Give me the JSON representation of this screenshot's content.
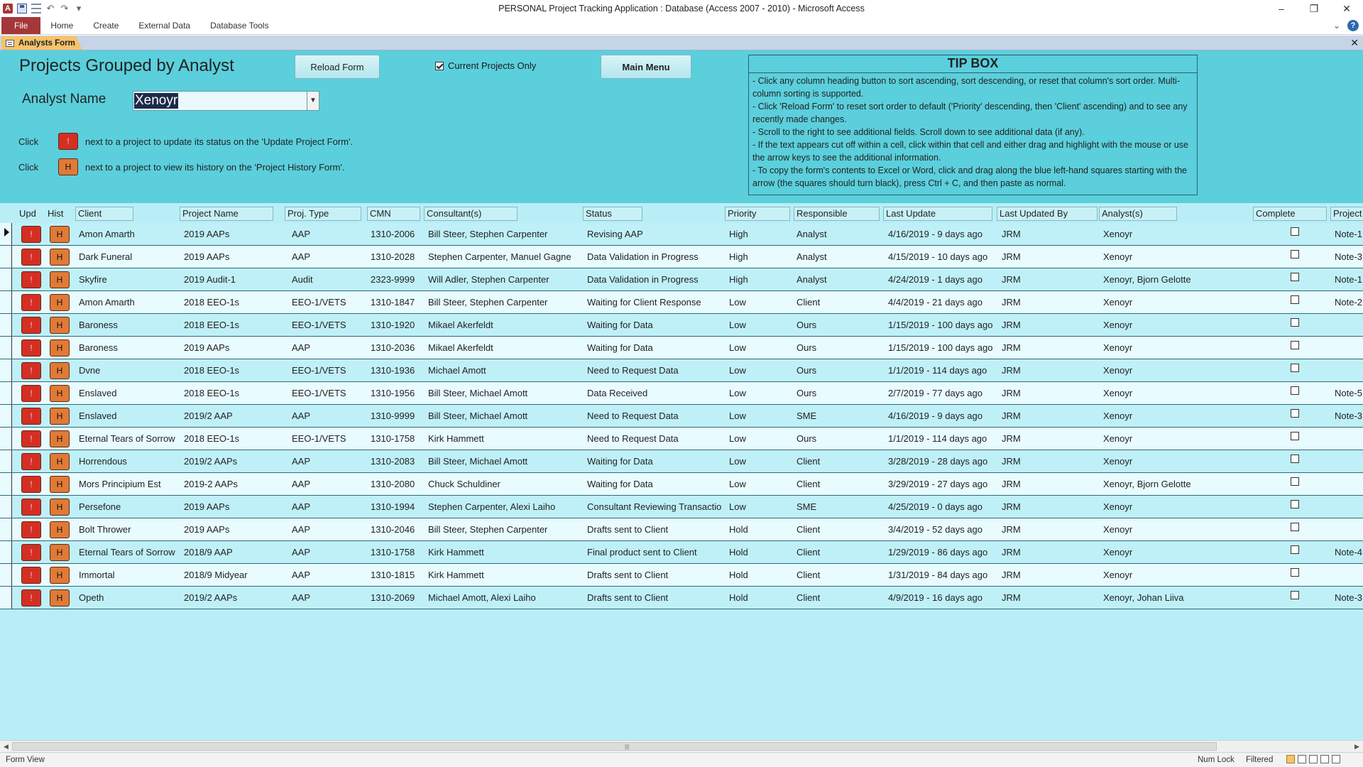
{
  "window": {
    "title": "PERSONAL Project Tracking Application : Database (Access 2007 - 2010)  -  Microsoft Access",
    "app_icon": "A",
    "minimize": "–",
    "restore": "❐",
    "close": "✕"
  },
  "ribbon": {
    "tabs": [
      "File",
      "Home",
      "Create",
      "External Data",
      "Database Tools"
    ],
    "collapse": "⌄",
    "help": "?"
  },
  "document": {
    "tab_label": "Analysts Form",
    "close": "✕"
  },
  "header": {
    "title": "Projects Grouped by Analyst",
    "reload_label": "Reload Form",
    "current_only_label": "Current Projects Only",
    "current_only_checked": true,
    "main_menu_label": "Main Menu",
    "analyst_label": "Analyst Name",
    "analyst_value": "Xenoyr",
    "help1_click": "Click",
    "help1_button": "!",
    "help1_text": "next to a project to update its status on the 'Update Project Form'.",
    "help2_click": "Click",
    "help2_button": "H",
    "help2_text": "next to a project to view its history on the 'Project History Form'."
  },
  "tipbox": {
    "title": "TIP BOX",
    "text": "- Click any column heading button to sort ascending, sort descending, or reset that column's sort order. Multi-column sorting is supported.\n- Click 'Reload Form' to reset sort order to default ('Priority' descending, then 'Client' ascending) and to see any recently made changes.\n- Scroll to the right to see additional fields. Scroll down to see additional data (if any).\n- If the text appears cut off within a cell, click within that cell and either drag and highlight with the mouse or use the arrow keys to see the additional information.\n- To copy the form's contents to Excel or Word, click and drag along the blue left-hand squares starting with the arrow (the squares should turn black), press Ctrl + C, and then paste as normal."
  },
  "columns": {
    "upd": "Upd",
    "hist": "Hist",
    "client": "Client",
    "project": "Project Name",
    "type": "Proj. Type",
    "cmn": "CMN",
    "consultants": "Consultant(s)",
    "status": "Status",
    "priority": "Priority",
    "responsible": "Responsible",
    "last_update": "Last Update",
    "last_by": "Last Updated By",
    "analysts": "Analyst(s)",
    "complete": "Complete",
    "notes": "Project"
  },
  "row_buttons": {
    "upd": "!",
    "hist": "H"
  },
  "rows": [
    {
      "client": "Amon Amarth",
      "project": "2019 AAPs",
      "type": "AAP",
      "cmn": "1310-2006",
      "consultants": "Bill Steer, Stephen Carpenter",
      "status": "Revising AAP",
      "priority": "High",
      "responsible": "Analyst",
      "last_update": "4/16/2019 - 9 days ago",
      "last_by": "JRM",
      "analysts": "Xenoyr",
      "complete": false,
      "notes": "Note-1"
    },
    {
      "client": "Dark Funeral",
      "project": "2019 AAPs",
      "type": "AAP",
      "cmn": "1310-2028",
      "consultants": "Stephen Carpenter, Manuel Gagne",
      "status": "Data Validation in Progress",
      "priority": "High",
      "responsible": "Analyst",
      "last_update": "4/15/2019 - 10 days ago",
      "last_by": "JRM",
      "analysts": "Xenoyr",
      "complete": false,
      "notes": "Note-3"
    },
    {
      "client": "Skyfire",
      "project": "2019 Audit-1",
      "type": "Audit",
      "cmn": "2323-9999",
      "consultants": "Will Adler, Stephen Carpenter",
      "status": "Data Validation in Progress",
      "priority": "High",
      "responsible": "Analyst",
      "last_update": "4/24/2019 - 1 days ago",
      "last_by": "JRM",
      "analysts": "Xenoyr, Bjorn Gelotte",
      "complete": false,
      "notes": "Note-1"
    },
    {
      "client": "Amon Amarth",
      "project": "2018 EEO-1s",
      "type": "EEO-1/VETS",
      "cmn": "1310-1847",
      "consultants": "Bill Steer, Stephen Carpenter",
      "status": "Waiting for Client Response",
      "priority": "Low",
      "responsible": "Client",
      "last_update": "4/4/2019 - 21 days ago",
      "last_by": "JRM",
      "analysts": "Xenoyr",
      "complete": false,
      "notes": "Note-2"
    },
    {
      "client": "Baroness",
      "project": "2018 EEO-1s",
      "type": "EEO-1/VETS",
      "cmn": "1310-1920",
      "consultants": "Mikael Akerfeldt",
      "status": "Waiting for Data",
      "priority": "Low",
      "responsible": "Ours",
      "last_update": "1/15/2019 - 100 days ago",
      "last_by": "JRM",
      "analysts": "Xenoyr",
      "complete": false,
      "notes": ""
    },
    {
      "client": "Baroness",
      "project": "2019 AAPs",
      "type": "AAP",
      "cmn": "1310-2036",
      "consultants": "Mikael Akerfeldt",
      "status": "Waiting for Data",
      "priority": "Low",
      "responsible": "Ours",
      "last_update": "1/15/2019 - 100 days ago",
      "last_by": "JRM",
      "analysts": "Xenoyr",
      "complete": false,
      "notes": ""
    },
    {
      "client": "Dvne",
      "project": "2018 EEO-1s",
      "type": "EEO-1/VETS",
      "cmn": "1310-1936",
      "consultants": "Michael Amott",
      "status": "Need to Request Data",
      "priority": "Low",
      "responsible": "Ours",
      "last_update": "1/1/2019 - 114 days ago",
      "last_by": "JRM",
      "analysts": "Xenoyr",
      "complete": false,
      "notes": ""
    },
    {
      "client": "Enslaved",
      "project": "2018 EEO-1s",
      "type": "EEO-1/VETS",
      "cmn": "1310-1956",
      "consultants": "Bill Steer, Michael Amott",
      "status": "Data Received",
      "priority": "Low",
      "responsible": "Ours",
      "last_update": "2/7/2019 - 77 days ago",
      "last_by": "JRM",
      "analysts": "Xenoyr",
      "complete": false,
      "notes": "Note-5"
    },
    {
      "client": "Enslaved",
      "project": "2019/2 AAP",
      "type": "AAP",
      "cmn": "1310-9999",
      "consultants": "Bill Steer, Michael Amott",
      "status": "Need to Request Data",
      "priority": "Low",
      "responsible": "SME",
      "last_update": "4/16/2019 - 9 days ago",
      "last_by": "JRM",
      "analysts": "Xenoyr",
      "complete": false,
      "notes": "Note-3"
    },
    {
      "client": "Eternal Tears of Sorrow",
      "project": "2018 EEO-1s",
      "type": "EEO-1/VETS",
      "cmn": "1310-1758",
      "consultants": "Kirk Hammett",
      "status": "Need to Request Data",
      "priority": "Low",
      "responsible": "Ours",
      "last_update": "1/1/2019 - 114 days ago",
      "last_by": "JRM",
      "analysts": "Xenoyr",
      "complete": false,
      "notes": ""
    },
    {
      "client": "Horrendous",
      "project": "2019/2 AAPs",
      "type": "AAP",
      "cmn": "1310-2083",
      "consultants": "Bill Steer, Michael Amott",
      "status": "Waiting for Data",
      "priority": "Low",
      "responsible": "Client",
      "last_update": "3/28/2019 - 28 days ago",
      "last_by": "JRM",
      "analysts": "Xenoyr",
      "complete": false,
      "notes": ""
    },
    {
      "client": "Mors Principium Est",
      "project": "2019-2 AAPs",
      "type": "AAP",
      "cmn": "1310-2080",
      "consultants": "Chuck Schuldiner",
      "status": "Waiting for Data",
      "priority": "Low",
      "responsible": "Client",
      "last_update": "3/29/2019 - 27 days ago",
      "last_by": "JRM",
      "analysts": "Xenoyr, Bjorn Gelotte",
      "complete": false,
      "notes": ""
    },
    {
      "client": "Persefone",
      "project": "2019 AAPs",
      "type": "AAP",
      "cmn": "1310-1994",
      "consultants": "Stephen Carpenter, Alexi Laiho",
      "status": "Consultant Reviewing Transactions",
      "priority": "Low",
      "responsible": "SME",
      "last_update": "4/25/2019 - 0 days ago",
      "last_by": "JRM",
      "analysts": "Xenoyr",
      "complete": false,
      "notes": ""
    },
    {
      "client": "Bolt Thrower",
      "project": "2019 AAPs",
      "type": "AAP",
      "cmn": "1310-2046",
      "consultants": "Bill Steer, Stephen Carpenter",
      "status": "Drafts sent to Client",
      "priority": "Hold",
      "responsible": "Client",
      "last_update": "3/4/2019 - 52 days ago",
      "last_by": "JRM",
      "analysts": "Xenoyr",
      "complete": false,
      "notes": ""
    },
    {
      "client": "Eternal Tears of Sorrow",
      "project": "2018/9 AAP",
      "type": "AAP",
      "cmn": "1310-1758",
      "consultants": "Kirk Hammett",
      "status": "Final product sent to Client",
      "priority": "Hold",
      "responsible": "Client",
      "last_update": "1/29/2019 - 86 days ago",
      "last_by": "JRM",
      "analysts": "Xenoyr",
      "complete": false,
      "notes": "Note-4"
    },
    {
      "client": "Immortal",
      "project": "2018/9 Midyear",
      "type": "AAP",
      "cmn": "1310-1815",
      "consultants": "Kirk Hammett",
      "status": "Drafts sent to Client",
      "priority": "Hold",
      "responsible": "Client",
      "last_update": "1/31/2019 - 84 days ago",
      "last_by": "JRM",
      "analysts": "Xenoyr",
      "complete": false,
      "notes": ""
    },
    {
      "client": "Opeth",
      "project": "2019/2 AAPs",
      "type": "AAP",
      "cmn": "1310-2069",
      "consultants": "Michael Amott, Alexi Laiho",
      "status": "Drafts sent to Client",
      "priority": "Hold",
      "responsible": "Client",
      "last_update": "4/9/2019 - 16 days ago",
      "last_by": "JRM",
      "analysts": "Xenoyr, Johan Liiva",
      "complete": false,
      "notes": "Note-3"
    }
  ],
  "status": {
    "view": "Form View",
    "numlock": "Num Lock",
    "filtered": "Filtered"
  },
  "scrollbar": {
    "left": "◀",
    "right": "▶",
    "grip": "|||"
  }
}
